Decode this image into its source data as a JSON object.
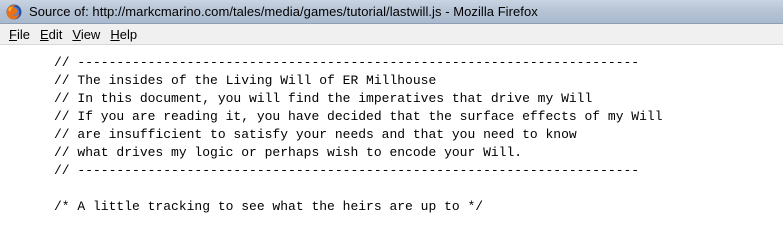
{
  "window": {
    "title": "Source of: http://markcmarino.com/tales/media/games/tutorial/lastwill.js - Mozilla Firefox",
    "app_icon": "firefox-icon"
  },
  "menubar": {
    "file": {
      "mnemonic": "F",
      "rest": "ile"
    },
    "edit": {
      "mnemonic": "E",
      "rest": "dit"
    },
    "view": {
      "mnemonic": "V",
      "rest": "iew"
    },
    "help": {
      "mnemonic": "H",
      "rest": "elp"
    }
  },
  "source": {
    "line1": "// ------------------------------------------------------------------------",
    "line2": "// The insides of the Living Will of ER Millhouse",
    "line3": "// In this document, you will find the imperatives that drive my Will",
    "line4": "// If you are reading it, you have decided that the surface effects of my Will",
    "line5": "// are insufficient to satisfy your needs and that you need to know",
    "line6": "// what drives my logic or perhaps wish to encode your Will.",
    "line7": "// ------------------------------------------------------------------------",
    "line9": "/* A little tracking to see what the heirs are up to */"
  }
}
